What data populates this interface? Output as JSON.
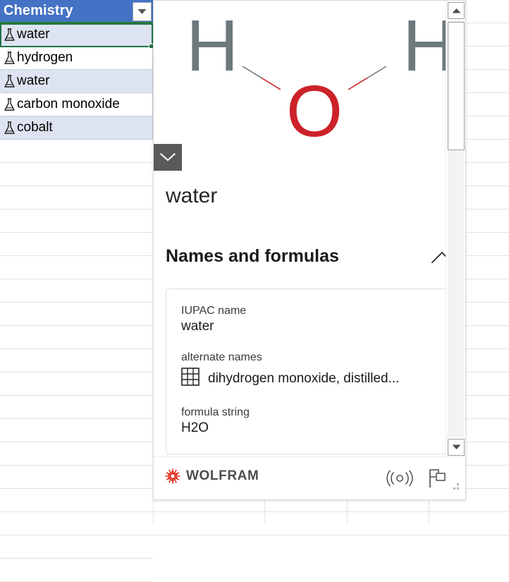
{
  "spreadsheet": {
    "header": {
      "label": "Chemistry",
      "filter_icon": "filter-dropdown-icon"
    },
    "rows": [
      {
        "label": "water",
        "icon": "chemical-flask-icon",
        "shaded": true,
        "selected": true
      },
      {
        "label": "hydrogen",
        "icon": "chemical-flask-icon",
        "shaded": false,
        "selected": false
      },
      {
        "label": "water",
        "icon": "chemical-flask-icon",
        "shaded": true,
        "selected": false
      },
      {
        "label": "carbon monoxide",
        "icon": "chemical-flask-icon",
        "shaded": false,
        "selected": false
      },
      {
        "label": "cobalt",
        "icon": "chemical-flask-icon",
        "shaded": true,
        "selected": false
      }
    ],
    "empty_row_count": 19
  },
  "card": {
    "collapse_button_icon": "chevron-down-icon",
    "title": "water",
    "molecule": {
      "atoms": [
        {
          "symbol": "H",
          "color": "#6d797c"
        },
        {
          "symbol": "H",
          "color": "#6d797c"
        },
        {
          "symbol": "O",
          "color": "#cc2229"
        }
      ],
      "bond_colors": {
        "hydrogen": "#6d797c",
        "oxygen": "#cc2229"
      }
    },
    "section": {
      "title": "Names and formulas",
      "expanded": true,
      "toggle_icon": "chevron-up-icon"
    },
    "properties": [
      {
        "label": "IUPAC name",
        "value": "water",
        "icon": null
      },
      {
        "label": "alternate names",
        "value": "dihydrogen monoxide, distilled...",
        "icon": "table-grid-icon"
      },
      {
        "label": "formula string",
        "value": "H2O",
        "icon": null
      }
    ],
    "footer": {
      "brand": "WOLFRAM",
      "brand_color": "#dd2b1c",
      "refresh_icon": "broadcast-refresh-icon",
      "flag_icon": "flag-icon",
      "resize_grip_icon": "resize-grip-icon"
    },
    "scrollbar": {
      "up_icon": "scroll-up-arrow-icon",
      "down_icon": "scroll-down-arrow-icon",
      "thumb": "scroll-thumb"
    }
  },
  "colors": {
    "header_blue": "#4472c4",
    "selection_green": "#217346",
    "row_shade": "#dde3f0",
    "grid_line": "#e2e2e2",
    "atom_oxygen": "#cc2229",
    "atom_hydrogen": "#6d797c"
  }
}
